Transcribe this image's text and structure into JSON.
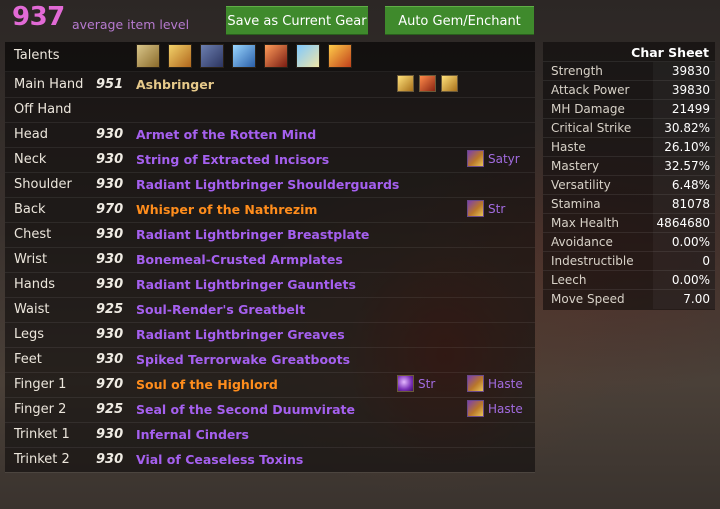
{
  "header": {
    "average_item_level": "937",
    "average_item_level_label": "average item level",
    "save_button": "Save as Current Gear",
    "auto_button": "Auto Gem/Enchant"
  },
  "talents_label": "Talents",
  "talent_icons": [
    "talent-1-icon",
    "talent-2-icon",
    "talent-3-icon",
    "talent-4-icon",
    "talent-5-icon",
    "talent-6-icon",
    "talent-7-icon"
  ],
  "gear": [
    {
      "slot": "Main Hand",
      "ilvl": "951",
      "item": "Ashbringer",
      "quality": "artifact",
      "relics": [
        "relic-holy-icon",
        "relic-fire-icon",
        "relic-holy-icon"
      ]
    },
    {
      "slot": "Off Hand",
      "ilvl": "",
      "item": "",
      "quality": ""
    },
    {
      "slot": "Head",
      "ilvl": "930",
      "item": "Armet of the Rotten Mind",
      "quality": "epic"
    },
    {
      "slot": "Neck",
      "ilvl": "930",
      "item": "String of Extracted Incisors",
      "quality": "epic",
      "enchant": "Satyr"
    },
    {
      "slot": "Shoulder",
      "ilvl": "930",
      "item": "Radiant Lightbringer Shoulderguards",
      "quality": "epic"
    },
    {
      "slot": "Back",
      "ilvl": "970",
      "item": "Whisper of the Nathrezim",
      "quality": "legendary",
      "enchant": "Str"
    },
    {
      "slot": "Chest",
      "ilvl": "930",
      "item": "Radiant Lightbringer Breastplate",
      "quality": "epic"
    },
    {
      "slot": "Wrist",
      "ilvl": "930",
      "item": "Bonemeal-Crusted Armplates",
      "quality": "epic"
    },
    {
      "slot": "Hands",
      "ilvl": "930",
      "item": "Radiant Lightbringer Gauntlets",
      "quality": "epic"
    },
    {
      "slot": "Waist",
      "ilvl": "925",
      "item": "Soul-Render's Greatbelt",
      "quality": "epic"
    },
    {
      "slot": "Legs",
      "ilvl": "930",
      "item": "Radiant Lightbringer Greaves",
      "quality": "epic"
    },
    {
      "slot": "Feet",
      "ilvl": "930",
      "item": "Spiked Terrorwake Greatboots",
      "quality": "epic"
    },
    {
      "slot": "Finger 1",
      "ilvl": "970",
      "item": "Soul of the Highlord",
      "quality": "legendary",
      "gem": "Str",
      "enchant": "Haste"
    },
    {
      "slot": "Finger 2",
      "ilvl": "925",
      "item": "Seal of the Second Duumvirate",
      "quality": "epic",
      "enchant": "Haste"
    },
    {
      "slot": "Trinket 1",
      "ilvl": "930",
      "item": "Infernal Cinders",
      "quality": "epic"
    },
    {
      "slot": "Trinket 2",
      "ilvl": "930",
      "item": "Vial of Ceaseless Toxins",
      "quality": "epic"
    }
  ],
  "quality_colors": {
    "artifact": "#e6c98a",
    "epic": "#a560ef",
    "legendary": "#ff8d1c"
  },
  "char_sheet": {
    "title": "Char Sheet",
    "stats": [
      {
        "name": "Strength",
        "value": "39830"
      },
      {
        "name": "Attack Power",
        "value": "39830"
      },
      {
        "name": "MH Damage",
        "value": "21499"
      },
      {
        "name": "Critical Strike",
        "value": "30.82%"
      },
      {
        "name": "Haste",
        "value": "26.10%"
      },
      {
        "name": "Mastery",
        "value": "32.57%"
      },
      {
        "name": "Versatility",
        "value": "6.48%"
      },
      {
        "name": "Stamina",
        "value": "81078"
      },
      {
        "name": "Max Health",
        "value": "4864680"
      },
      {
        "name": "Avoidance",
        "value": "0.00%"
      },
      {
        "name": "Indestructible",
        "value": "0"
      },
      {
        "name": "Leech",
        "value": "0.00%"
      },
      {
        "name": "Move Speed",
        "value": "7.00"
      }
    ]
  }
}
